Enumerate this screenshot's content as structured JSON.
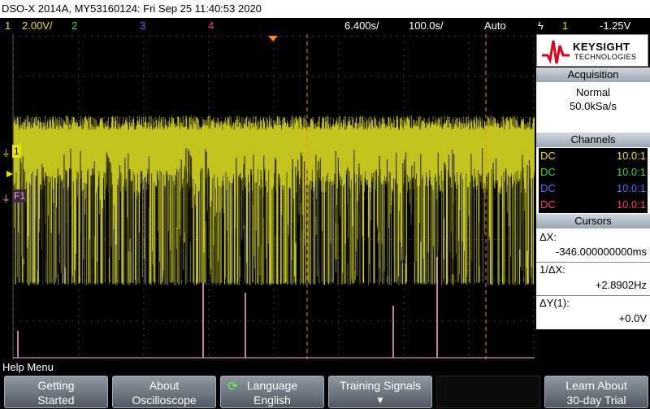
{
  "title": "DSO-X 2014A, MY53160124: Fri Sep 25 11:40:53 2020",
  "status": {
    "ch1_label": "1",
    "ch1_scale": "2.00V/",
    "ch2_label": "2",
    "ch3_label": "3",
    "ch4_label": "4",
    "timebase": "6.400s/",
    "delay": "100.0s/",
    "trigger_mode": "Auto",
    "trigger_source": "1",
    "trigger_level": "-1.25V"
  },
  "colors": {
    "ch1": "#e6e600",
    "ch2": "#33dd33",
    "ch3": "#5566ff",
    "ch4": "#ff3377",
    "cursor": "#ff8800",
    "math": "#ffaadd"
  },
  "screen": {
    "ch1_marker": "1",
    "math_marker": "F1"
  },
  "brand": {
    "name": "KEYSIGHT",
    "sub": "TECHNOLOGIES"
  },
  "acquisition": {
    "header": "Acquisition",
    "mode": "Normal",
    "rate": "50.0kSa/s"
  },
  "channels": {
    "header": "Channels",
    "rows": [
      {
        "coupling": "DC",
        "probe": "10.0:1"
      },
      {
        "coupling": "DC",
        "probe": "10.0:1"
      },
      {
        "coupling": "DC",
        "probe": "10.0:1"
      },
      {
        "coupling": "DC",
        "probe": "10.0:1"
      }
    ]
  },
  "cursors": {
    "header": "Cursors",
    "dx_label": "ΔX:",
    "dx_value": "-346.000000000ms",
    "inv_label": "1/ΔX:",
    "inv_value": "+2.8902Hz",
    "dy_label": "ΔY(1):",
    "dy_value": "+0.0V"
  },
  "help_menu": "Help Menu",
  "softkeys": {
    "k1_line1": "Getting",
    "k1_line2": "Started",
    "k2_line1": "About",
    "k2_line2": "Oscilloscope",
    "k3_line1": "Language",
    "k3_line2": "English",
    "k4_line1": "Training Signals",
    "k5_line1": "Learn About",
    "k5_line2": "30-day Trial"
  }
}
